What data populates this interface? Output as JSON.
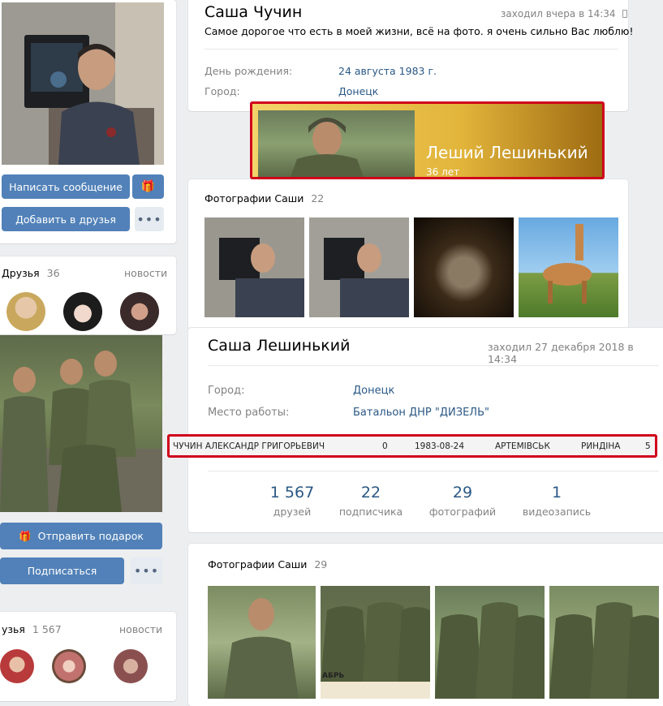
{
  "top_profile": {
    "name": "Саша Чучин",
    "last_seen": "заходил вчера в 14:34",
    "status": "Самое дорогое что есть в моей жизни, всё на фото. я очень сильно Вас люблю!",
    "birthday_label": "День рождения:",
    "birthday_value": "24 августа 1983 г.",
    "city_label": "Город:",
    "city_value": "Донецк",
    "write_message": "Написать сообщение",
    "add_friend": "Добавить в друзья",
    "friends_label": "Друзья",
    "friends_count": "36",
    "news_label": "новости",
    "photos_label": "Фотографии Саши",
    "photos_count": "22"
  },
  "ok_card": {
    "name": "Леший Лешинький",
    "age": "36 лет"
  },
  "bottom_profile": {
    "name": "Саша Лешинький",
    "last_seen": "заходил 27 декабря 2018 в 14:34",
    "city_label": "Город:",
    "city_value": "Донецк",
    "work_label": "Место работы:",
    "work_value": "Батальон ДНР \"ДИЗЕЛЬ\"",
    "send_gift": "Отправить подарок",
    "subscribe": "Подписаться",
    "friends_label": "узья",
    "friends_count": "1 567",
    "news_label": "новости",
    "photos_label": "Фотографии Саши",
    "photos_count": "29",
    "stats": [
      {
        "num": "1 567",
        "label": "друзей"
      },
      {
        "num": "22",
        "label": "подписчика"
      },
      {
        "num": "29",
        "label": "фотографий"
      },
      {
        "num": "1",
        "label": "видеозапись"
      }
    ]
  },
  "db_row": {
    "name": "ЧУЧИН АЛЕКСАНДР ГРИГОРЬЕВИЧ",
    "col2": "0",
    "date": "1983-08-24",
    "city": "АРТЕМIВСЬК",
    "region": "РИНДІНА",
    "num": "5"
  },
  "overlay_text": {
    "calendar_month": "АБРЬ"
  },
  "colors": {
    "accent": "#5181b8",
    "link": "#2a5885",
    "highlight_border": "#d0021b",
    "background": "#edeef0"
  }
}
